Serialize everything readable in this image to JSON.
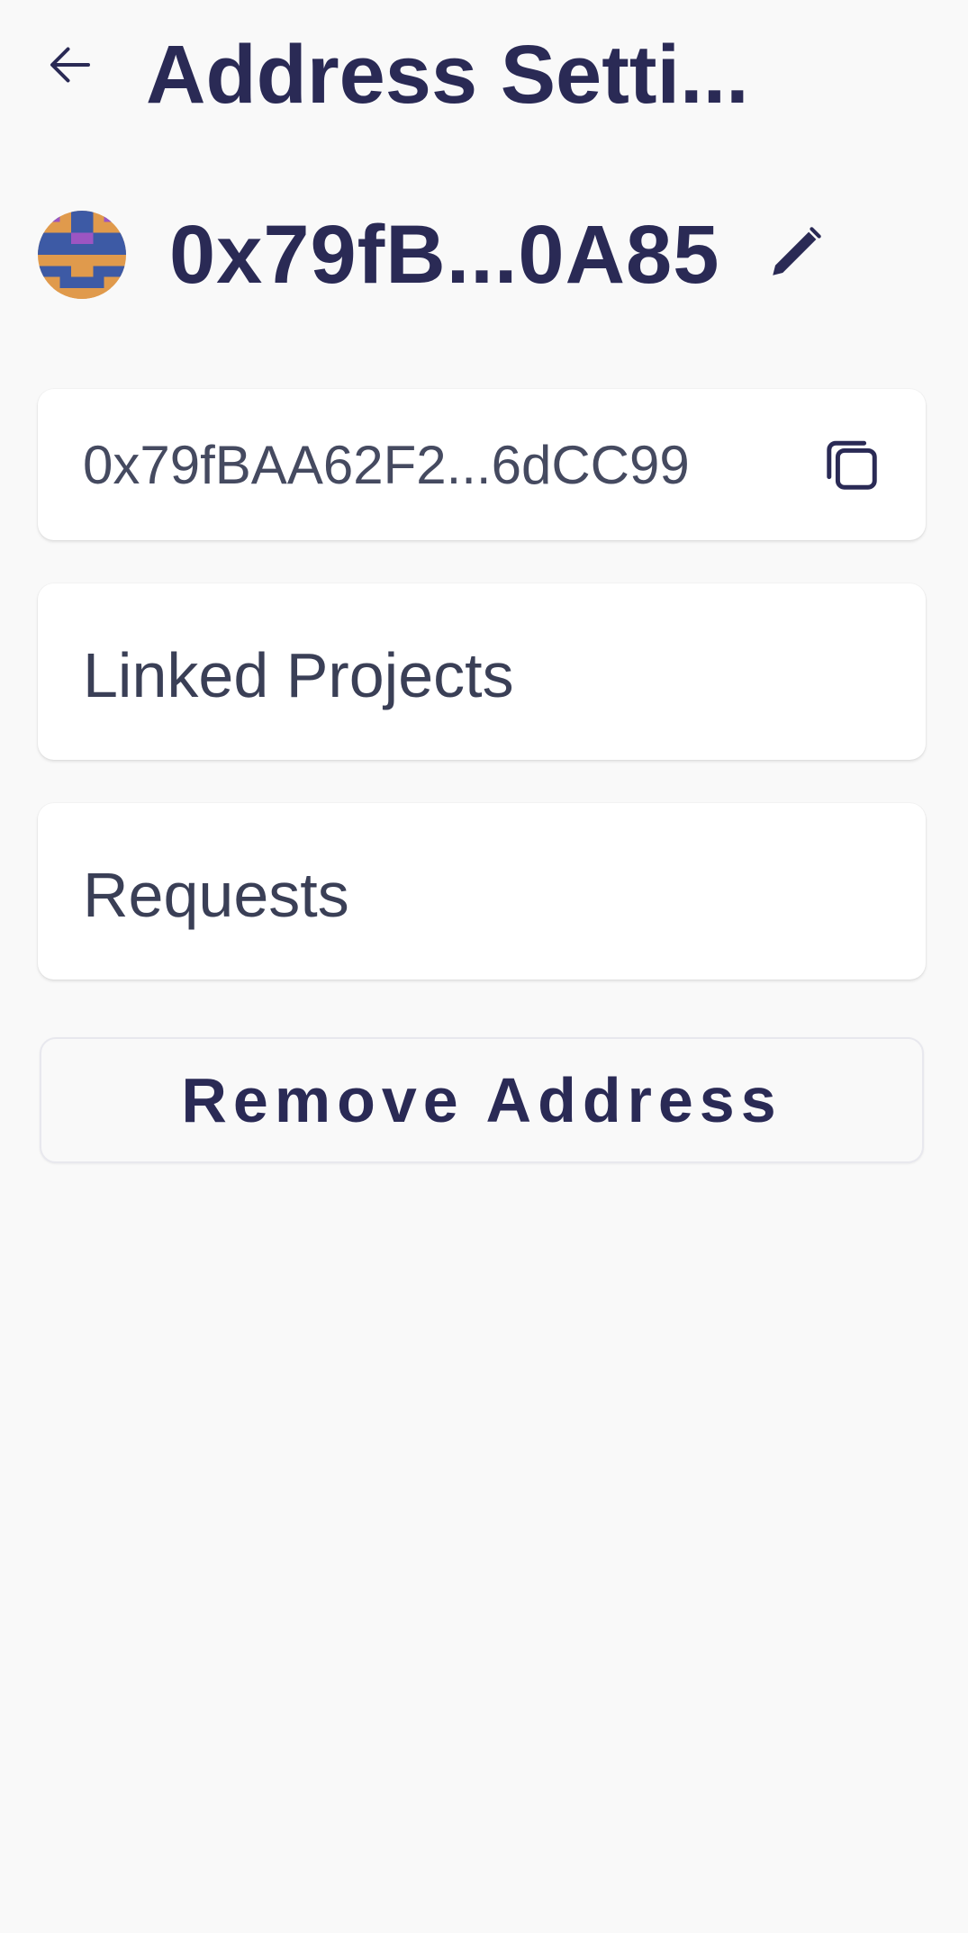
{
  "header": {
    "title": "Address Setti...",
    "back_icon": "arrow-left-icon"
  },
  "identity": {
    "short_address": "0x79fB...0A85",
    "avatar_icon": "pixel-avatar-icon",
    "edit_icon": "pencil-icon"
  },
  "address_card": {
    "full_address": "0x79fBAA62F2...6dCC99",
    "copy_icon": "copy-icon"
  },
  "menu": {
    "linked_projects": "Linked Projects",
    "requests": "Requests"
  },
  "actions": {
    "remove_address": "Remove Address"
  },
  "colors": {
    "background": "#f9f9f9",
    "primary_text": "#2a2a55",
    "secondary_text": "#3a3f56",
    "card": "#ffffff",
    "avatar_blue": "#3d5aa5",
    "avatar_orange": "#e09a4c",
    "avatar_purple": "#9c55c2"
  }
}
